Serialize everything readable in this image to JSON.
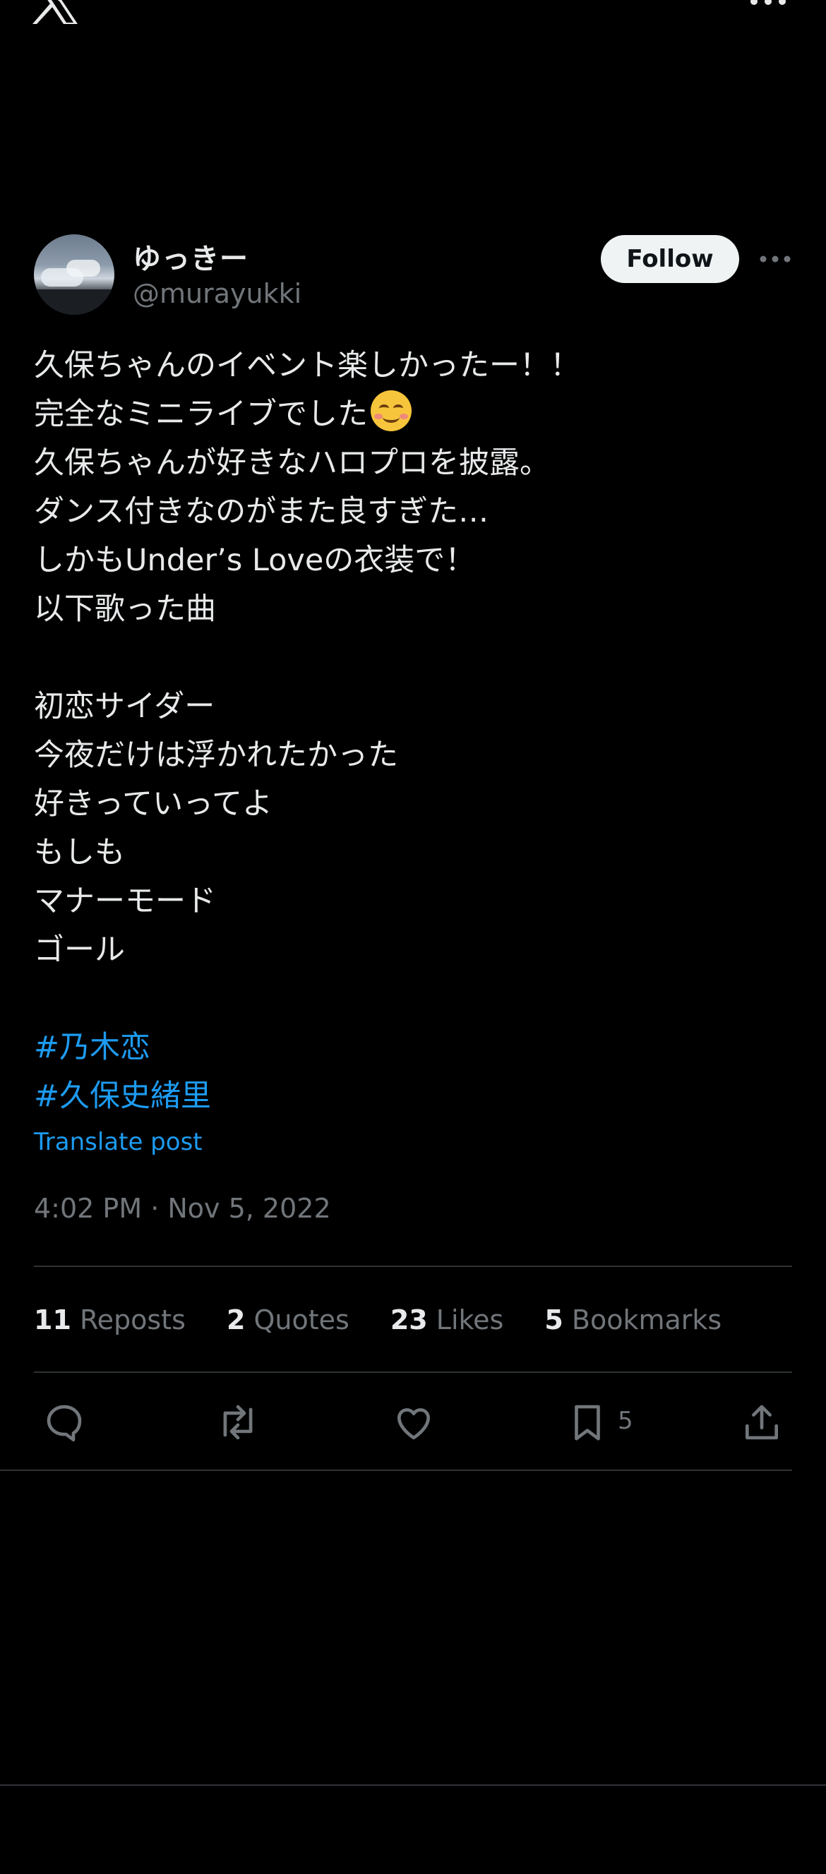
{
  "header": {
    "display_name": "ゆっきー",
    "handle": "@murayukki",
    "follow_label": "Follow"
  },
  "post": {
    "lines": [
      "久保ちゃんのイベント楽しかったー！！",
      "完全なミニライブでした",
      "久保ちゃんが好きなハロプロを披露。",
      "ダンス付きなのがまた良すぎた…",
      "しかもUnder’s Loveの衣装で！",
      "以下歌った曲"
    ],
    "emoji": "smiling-face-with-smiling-eyes",
    "songs": [
      "初恋サイダー",
      "今夜だけは浮かれたかった",
      "好きっていってよ",
      "もしも",
      "マナーモード",
      "ゴール"
    ],
    "hashtags": [
      "#乃木恋",
      "#久保史緒里"
    ],
    "translate_label": "Translate post",
    "timestamp": "4:02 PM · Nov 5, 2022"
  },
  "stats": {
    "reposts_count": "11",
    "reposts_label": "Reposts",
    "quotes_count": "2",
    "quotes_label": "Quotes",
    "likes_count": "23",
    "likes_label": "Likes",
    "bookmarks_count": "5",
    "bookmarks_label": "Bookmarks"
  },
  "actions": {
    "bookmark_count": "5",
    "icons": [
      "reply-icon",
      "repost-icon",
      "like-icon",
      "bookmark-icon",
      "share-icon"
    ]
  },
  "colors": {
    "background": "#000000",
    "text": "#e7e9ea",
    "muted": "#71767b",
    "accent": "#1d9bf0",
    "divider": "#2f3336"
  }
}
